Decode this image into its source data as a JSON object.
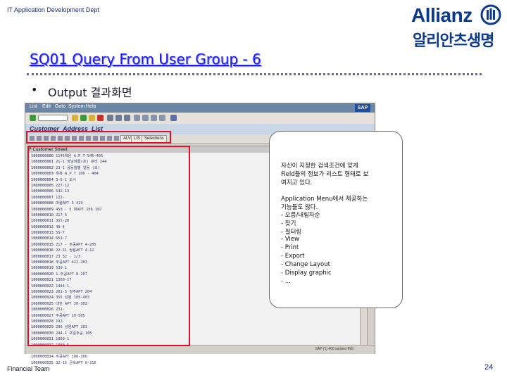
{
  "header": {
    "department": "IT Application Development Dept"
  },
  "logo": {
    "english": "Allianz",
    "korean": "알리안츠생명"
  },
  "slide": {
    "title": "SQ01 Query From User Group - 6",
    "bullet": "Output 결과화면"
  },
  "sap": {
    "menus": [
      "List",
      "Edit",
      "Goto",
      "System",
      "Help"
    ],
    "brand": "SAP",
    "app_title": "Customer_Address_List",
    "toolbar_buttons": [
      "ALV",
      "LIS",
      "Selections"
    ],
    "list_header": "P  Customer  Street",
    "status": "SAP  (1) 400   suntest  INS",
    "rows": [
      [
        "1000000000",
        "1145해운 A.P.T 945~405"
      ],
      [
        "1000000001",
        "21-1 정남마을(호) 관리 244"
      ],
      [
        "1000000002",
        "23-1 공동월별 일동 (호)"
      ],
      [
        "1000000003",
        "흑흑 A.P.T 106 - 404"
      ],
      [
        "1000000004",
        "3-6-1 도시"
      ],
      [
        "1000000005",
        "227-12"
      ],
      [
        "1000000006",
        "542-13"
      ],
      [
        "1000000007",
        "122-"
      ],
      [
        "1000000008",
        "마을APT 5-419"
      ],
      [
        "1000000009",
        "450 - 5 대APT 106 107"
      ],
      [
        "1000000010",
        "217 5"
      ],
      [
        "1000000011",
        "355-20"
      ],
      [
        "1000000012",
        "49-4"
      ],
      [
        "1000000013",
        "55-7"
      ],
      [
        "1000000014",
        "653-7"
      ],
      [
        "1000000015",
        "217 - 주공APT 4-205"
      ],
      [
        "1000000016",
        "22-31 쌍용APT 4-12"
      ],
      [
        "1000000017",
        "23 32 - 1/3"
      ],
      [
        "1000000018",
        "주공APT 421-203"
      ],
      [
        "1000000019",
        "539-1"
      ],
      [
        "1000000020",
        "1-주공APT 8-207"
      ],
      [
        "1000000021",
        "1360-17"
      ],
      [
        "1000000022",
        "1444-1"
      ],
      [
        "1000000023",
        "201-5 쌍주APT 204"
      ],
      [
        "1000000024",
        "355 성원 105-403"
      ],
      [
        "1000000025",
        "대한 APT 20-302"
      ],
      [
        "1000000026",
        "231-"
      ],
      [
        "1000000027",
        "주공APT 19-505"
      ],
      [
        "1000000028",
        "192-"
      ],
      [
        "1000000029",
        "206 성원APT 103"
      ],
      [
        "1000000030",
        "244-1 포일주공 105"
      ],
      [
        "1000000031",
        "1069-1"
      ],
      [
        "1000000032",
        "1080-5"
      ],
      [
        "1000000033",
        "516-9"
      ],
      [
        "1000000034",
        "주공APT 108-306"
      ],
      [
        "1000000035",
        "32-15 금호APT 8-216"
      ]
    ]
  },
  "callout": {
    "lines": [
      "자신이 지정한 검색조건에 맞게",
      "Field들의 정보가 리스트 형태로 보",
      "여지고 있다.",
      "",
      "Application Menu에서 제공하는",
      "기능들도 많다.",
      " - 오름/내림차순",
      " - 찾기",
      " - 필터링",
      " - View",
      " - Print",
      " - Export",
      " - Change Layout",
      " - Display graphic",
      " - ..."
    ]
  },
  "footer": {
    "team": "Financial Team",
    "page": "24"
  },
  "colors": {
    "title": "#1a1aff",
    "highlight": "#e0102a",
    "brand": "#0b3a8c"
  }
}
